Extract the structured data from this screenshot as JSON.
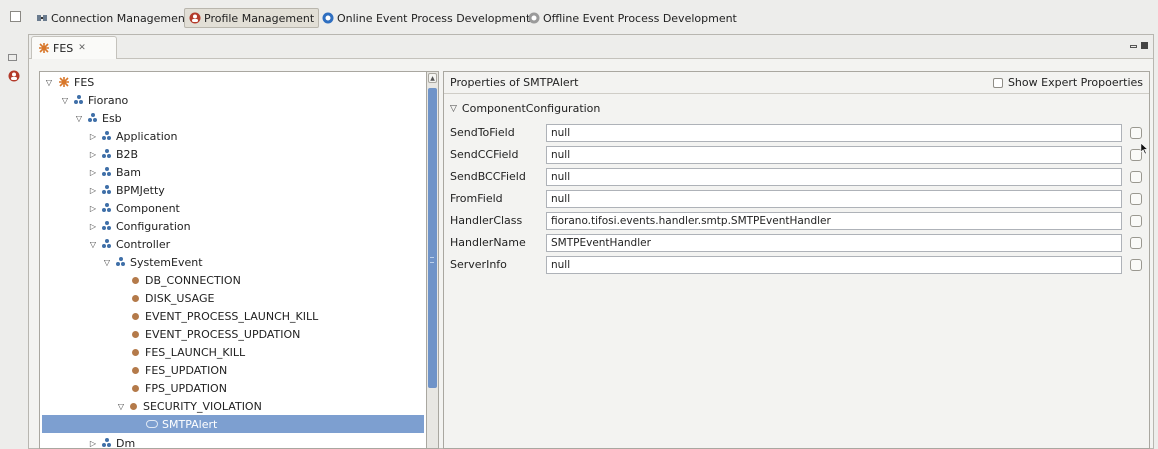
{
  "toolbar": {
    "perspectives": [
      {
        "label": "Connection Management",
        "icon": "connection-icon",
        "active": false
      },
      {
        "label": "Profile Management",
        "icon": "profile-icon",
        "active": true
      },
      {
        "label": "Online Event Process Development",
        "icon": "online-icon",
        "active": false
      },
      {
        "label": "Offline Event Process Development",
        "icon": "offline-icon",
        "active": false
      }
    ]
  },
  "view": {
    "tab_label": "FES",
    "tab_close": "✕"
  },
  "tree": {
    "items": [
      {
        "label": "FES"
      },
      {
        "label": "Fiorano"
      },
      {
        "label": "Esb"
      },
      {
        "label": "Application"
      },
      {
        "label": "B2B"
      },
      {
        "label": "Bam"
      },
      {
        "label": "BPMJetty"
      },
      {
        "label": "Component"
      },
      {
        "label": "Configuration"
      },
      {
        "label": "Controller"
      },
      {
        "label": "SystemEvent"
      },
      {
        "label": "DB_CONNECTION"
      },
      {
        "label": "DISK_USAGE"
      },
      {
        "label": "EVENT_PROCESS_LAUNCH_KILL"
      },
      {
        "label": "EVENT_PROCESS_UPDATION"
      },
      {
        "label": "FES_LAUNCH_KILL"
      },
      {
        "label": "FES_UPDATION"
      },
      {
        "label": "FPS_UPDATION"
      },
      {
        "label": "SECURITY_VIOLATION"
      },
      {
        "label": "SMTPAlert",
        "selected": true
      },
      {
        "label": "Dm"
      }
    ]
  },
  "properties": {
    "title": "Properties of SMTPAlert",
    "expert_label": "Show Expert Propoerties",
    "section": "ComponentConfiguration",
    "rows": [
      {
        "label": "SendToField",
        "value": "null"
      },
      {
        "label": "SendCCField",
        "value": "null"
      },
      {
        "label": "SendBCCField",
        "value": "null"
      },
      {
        "label": "FromField",
        "value": "null"
      },
      {
        "label": "HandlerClass",
        "value": "fiorano.tifosi.events.handler.smtp.SMTPEventHandler"
      },
      {
        "label": "HandlerName",
        "value": "SMTPEventHandler"
      },
      {
        "label": "ServerInfo",
        "value": "null"
      }
    ]
  },
  "colors": {
    "selection": "#7d9fd0",
    "scroll_thumb": "#6f93c8"
  }
}
